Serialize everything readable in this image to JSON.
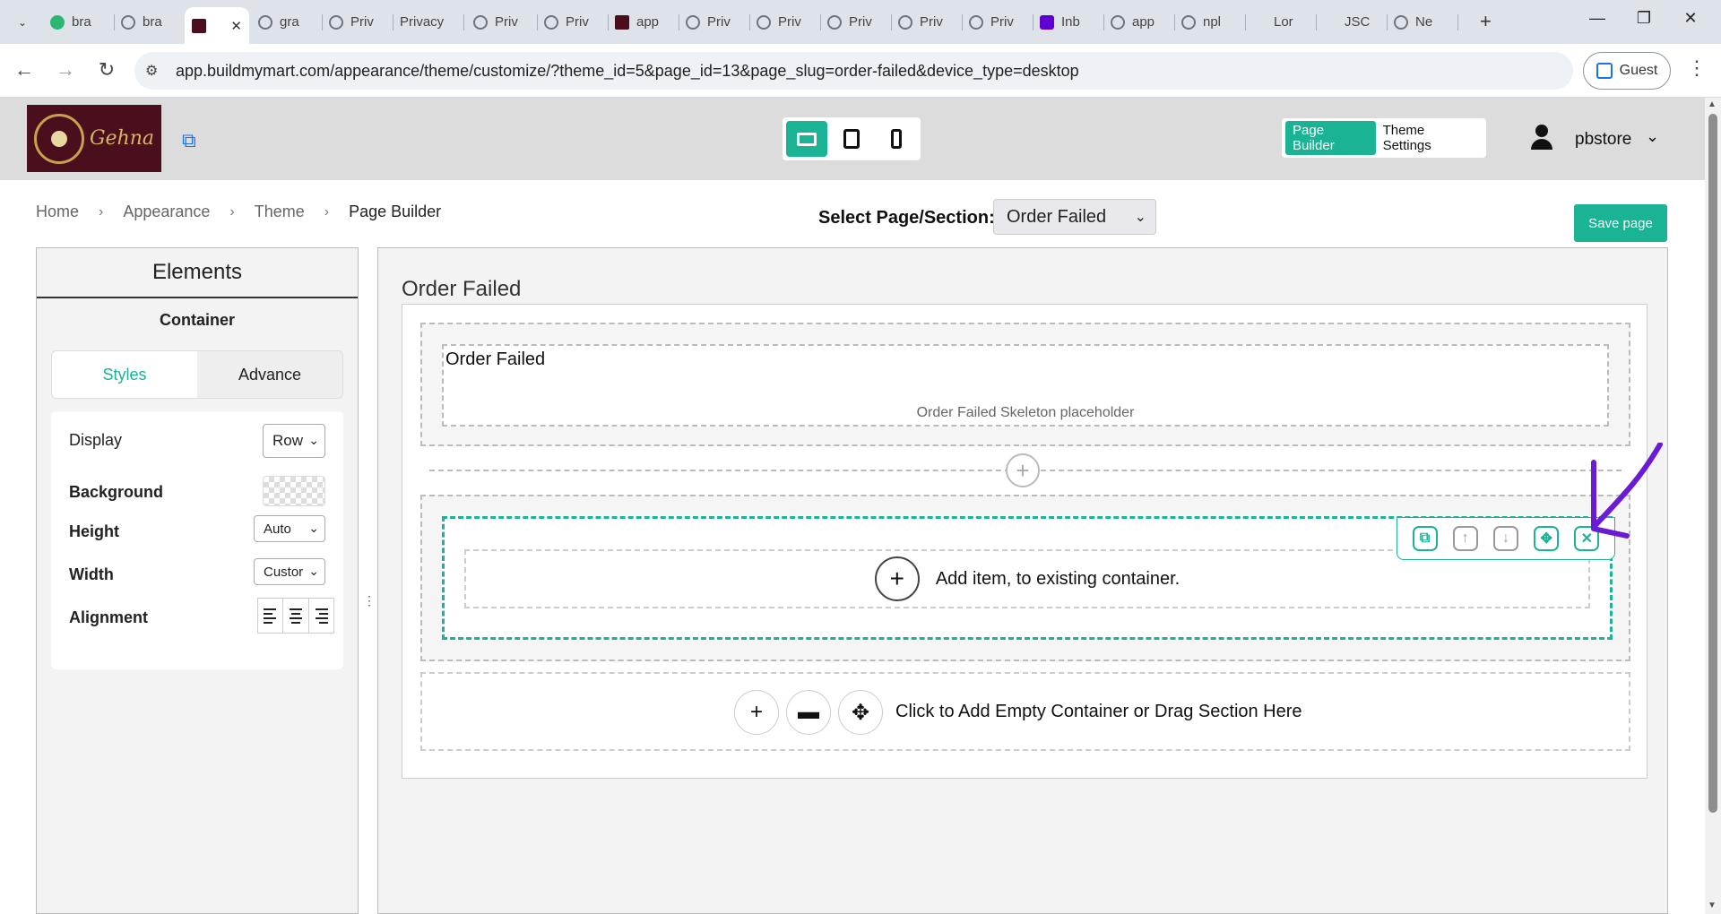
{
  "browser": {
    "tabs": [
      {
        "label": "bra",
        "favicon": "gem-icon"
      },
      {
        "label": "bra",
        "favicon": "globe-icon"
      },
      {
        "label": "",
        "favicon": "site-logo-icon",
        "active": true
      },
      {
        "label": "gra",
        "favicon": "globe-icon"
      },
      {
        "label": "Priv",
        "favicon": "globe-icon"
      },
      {
        "label": "Privacy",
        "favicon": "none"
      },
      {
        "label": "Priv",
        "favicon": "globe-icon"
      },
      {
        "label": "Priv",
        "favicon": "globe-icon"
      },
      {
        "label": "app",
        "favicon": "site-logo-icon"
      },
      {
        "label": "Priv",
        "favicon": "globe-icon"
      },
      {
        "label": "Priv",
        "favicon": "globe-icon"
      },
      {
        "label": "Priv",
        "favicon": "globe-icon"
      },
      {
        "label": "Priv",
        "favicon": "globe-icon"
      },
      {
        "label": "Priv",
        "favicon": "globe-icon"
      },
      {
        "label": "Inb",
        "favicon": "yahoo-icon"
      },
      {
        "label": "app",
        "favicon": "globe-icon"
      },
      {
        "label": "npl",
        "favicon": "globe-icon"
      },
      {
        "label": "Lor",
        "favicon": "l-icon"
      },
      {
        "label": "JSC",
        "favicon": "braces-icon"
      },
      {
        "label": "Ne",
        "favicon": "globe-icon"
      }
    ],
    "active_tab_close": "✕",
    "new_tab": "+",
    "url": "app.buildmymart.com/appearance/theme/customize/?theme_id=5&page_id=13&page_slug=order-failed&device_type=desktop",
    "profile_label": "Guest"
  },
  "header": {
    "logo_text": "Gehna",
    "mode_tabs": [
      "Page Builder",
      "Theme Settings"
    ],
    "active_mode": "Page Builder",
    "username": "pbstore"
  },
  "breadcrumb": [
    "Home",
    "Appearance",
    "Theme",
    "Page Builder"
  ],
  "page_select": {
    "label": "Select Page/Section:",
    "value": "Order Failed"
  },
  "save_button": "Save page",
  "elements_panel": {
    "title": "Elements",
    "subtitle": "Container",
    "tabs": [
      "Styles",
      "Advance"
    ],
    "active_tab": "Styles",
    "props": {
      "display_label": "Display",
      "display_value": "Row",
      "background_label": "Background",
      "height_label": "Height",
      "height_value": "Auto",
      "width_label": "Width",
      "width_value": "Custor",
      "alignment_label": "Alignment"
    }
  },
  "canvas": {
    "title": "Order Failed",
    "section1_heading": "Order Failed",
    "section1_placeholder": "Order Failed Skeleton placeholder",
    "add_item_text": "Add item, to existing container.",
    "add_container_text": "Click to Add Empty Container or Drag Section Here"
  },
  "colors": {
    "accent": "#1ab394",
    "header_bg": "#dcdcdc",
    "annotation": "#6a1bd6"
  }
}
